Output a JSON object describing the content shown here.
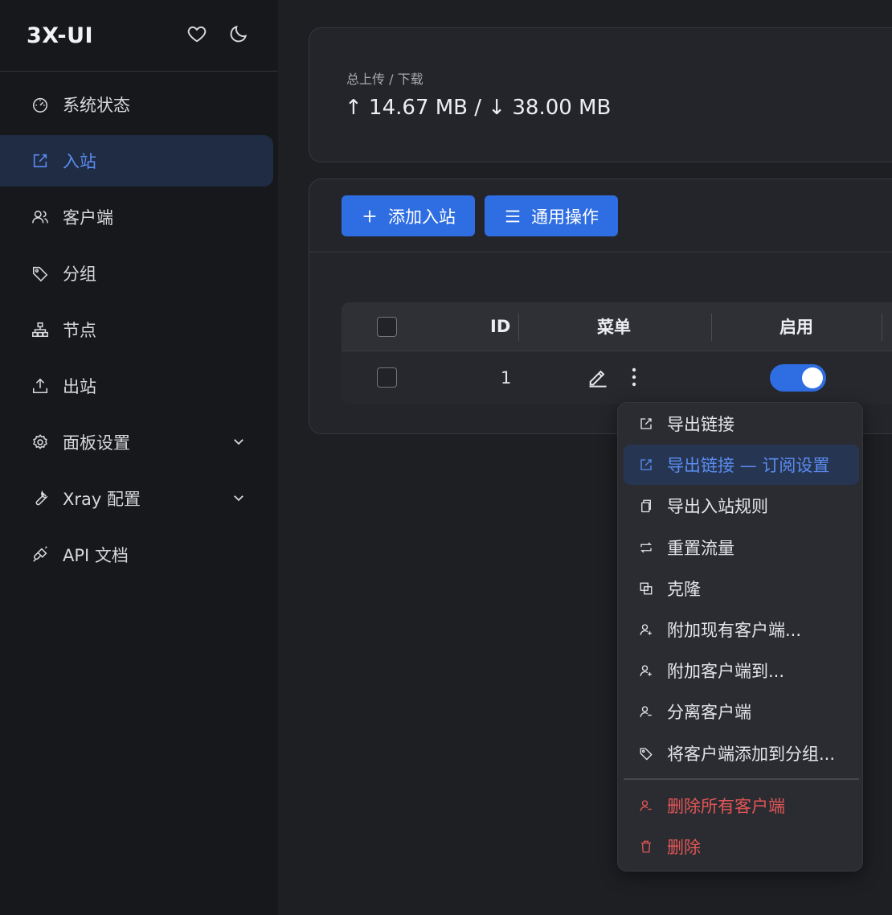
{
  "brand": {
    "title": "3X-UI"
  },
  "sidebar": {
    "items": [
      {
        "label": "系统状态",
        "icon": "dashboard-icon"
      },
      {
        "label": "入站",
        "icon": "edit-square-icon",
        "active": true
      },
      {
        "label": "客户端",
        "icon": "users-icon"
      },
      {
        "label": "分组",
        "icon": "tag-icon"
      },
      {
        "label": "节点",
        "icon": "cluster-icon"
      },
      {
        "label": "出站",
        "icon": "upload-icon"
      },
      {
        "label": "面板设置",
        "icon": "gear-icon",
        "expandable": true
      },
      {
        "label": "Xray 配置",
        "icon": "tool-icon",
        "expandable": true
      },
      {
        "label": "API 文档",
        "icon": "api-icon"
      }
    ]
  },
  "stats": {
    "label": "总上传 / 下载",
    "value": "↑ 14.67 MB / ↓ 38.00 MB"
  },
  "toolbar": {
    "add_label": "添加入站",
    "general_label": "通用操作"
  },
  "table": {
    "headers": {
      "id": "ID",
      "menu": "菜单",
      "enable": "启用"
    },
    "rows": [
      {
        "id": "1",
        "enabled": true
      }
    ]
  },
  "menu": {
    "items": [
      {
        "label": "导出链接",
        "icon": "export-icon"
      },
      {
        "label": "导出链接 — 订阅设置",
        "icon": "export-icon",
        "highlight": true
      },
      {
        "label": "导出入站规则",
        "icon": "copy-icon"
      },
      {
        "label": "重置流量",
        "icon": "retweet-icon"
      },
      {
        "label": "克隆",
        "icon": "block-icon"
      },
      {
        "label": "附加现有客户端...",
        "icon": "user-add-icon"
      },
      {
        "label": "附加客户端到...",
        "icon": "user-add-icon"
      },
      {
        "label": "分离客户端",
        "icon": "user-delete-icon"
      },
      {
        "label": "将客户端添加到分组...",
        "icon": "tag-icon"
      },
      {
        "label": "删除所有客户端",
        "icon": "user-delete-icon",
        "danger": true
      },
      {
        "label": "删除",
        "icon": "trash-icon",
        "danger": true
      }
    ]
  },
  "colors": {
    "accent": "#2f6ee2",
    "danger": "#e25656",
    "active_text": "#5b8cf0"
  }
}
